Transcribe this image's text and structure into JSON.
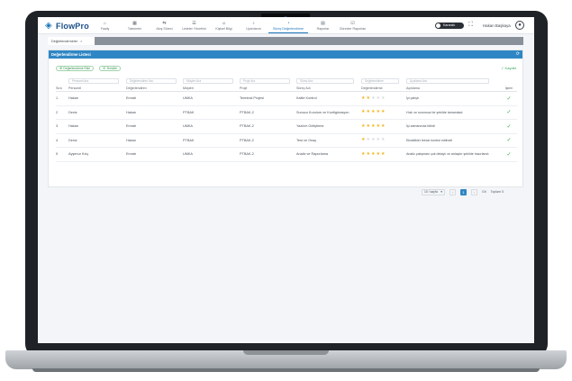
{
  "app": {
    "logo_text": "FlowPro"
  },
  "nav": {
    "items": [
      {
        "label": "Faaliy",
        "icon": "home-icon"
      },
      {
        "label": "Takvimler",
        "icon": "calendar-icon"
      },
      {
        "label": "Akış Süreci",
        "icon": "flow-icon"
      },
      {
        "label": "Listeler Yönetimi",
        "icon": "list-icon"
      },
      {
        "label": "Kişisel Bilgi",
        "icon": "user-icon"
      },
      {
        "label": "Uyarılarım",
        "icon": "bell-icon"
      },
      {
        "label": "Süreç Değerlendirme",
        "icon": "chart-icon"
      },
      {
        "label": "Raporlar",
        "icon": "report-icon"
      },
      {
        "label": "Görevler Raporları",
        "icon": "task-icon"
      }
    ],
    "active_index": 6
  },
  "topbar": {
    "toggle_label": "Karanlık",
    "user_name": "Hakan Başkaya"
  },
  "tabs": {
    "page_tab_label": "Değerlendirmeler",
    "close_glyph": "×"
  },
  "panel": {
    "title": "Değerlendirme Listesi",
    "chip_primary": "Değerlendirme Ekle",
    "chip_secondary": "Temizle",
    "save_label": "Kaydet"
  },
  "table": {
    "filters": [
      "Personel Ara",
      "Değerlendiren Ara",
      "Müşteri Ara",
      "Proje Ara",
      "Süreç Ara",
      "Değerlendirme",
      "Açıklama Ara"
    ],
    "headers": [
      "Sıra",
      "Personel",
      "Değerlendiren",
      "Müşteri",
      "Proje",
      "Süreç Adı",
      "Değerlendirme",
      "Açıklama",
      "İşlem"
    ],
    "rows": [
      {
        "no": "1",
        "personel": "Hakan",
        "degerlendiren": "Emrah",
        "musteri": "UMKA",
        "proje": "Terminal Projesi",
        "surec": "Kalite Kontrol",
        "rating": 2,
        "aciklama": "İyi çalıştı"
      },
      {
        "no": "2",
        "personel": "Deniz",
        "degerlendiren": "Hakan",
        "musteri": "PTBAK",
        "proje": "PTBAK-2",
        "surec": "Sunucu Kurulum ve Konfigürasyon",
        "rating": 5,
        "aciklama": "Hızlı ve sorunsuz bir şekilde tamamladı"
      },
      {
        "no": "3",
        "personel": "Hakan",
        "degerlendiren": "Emrah",
        "musteri": "UMKA",
        "proje": "PTBAK-2",
        "surec": "Yazılım Geliştirme",
        "rating": 5,
        "aciklama": "İşi zamanında bitirdi"
      },
      {
        "no": "4",
        "personel": "Deniz",
        "degerlendiren": "Hakan",
        "musteri": "PTBAK",
        "proje": "PTBAK-2",
        "surec": "Test ve Onay",
        "rating": 1,
        "aciklama": "Eksiklikler tekrar kontrol edilmeli"
      },
      {
        "no": "5",
        "personel": "Ayşenur Kılıç",
        "degerlendiren": "Emrah",
        "musteri": "UMKA",
        "proje": "PTBAK-2",
        "surec": "Analiz ve Raporlama",
        "rating": 5,
        "aciklama": "Analiz çalışması çok detaylı ve anlaşılır şekilde hazırlandı"
      }
    ],
    "max_rating": 5
  },
  "pager": {
    "page_size": "10 / sayfa",
    "prev": "‹",
    "current": "1",
    "next": "›",
    "go_label": "Git",
    "summary": "Toplam 5"
  }
}
